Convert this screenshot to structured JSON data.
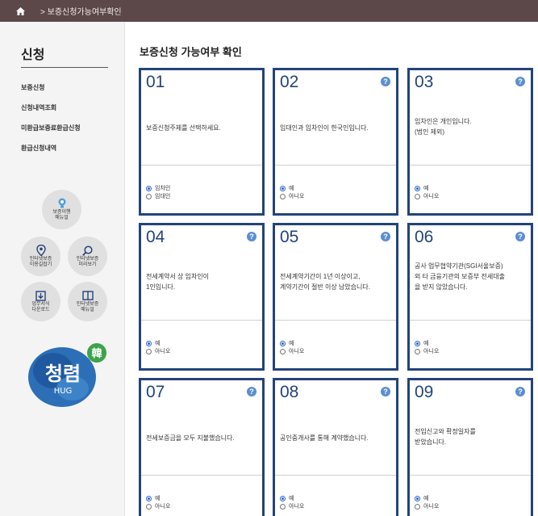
{
  "topbar": {
    "breadcrumb": "> 보증신청가능여부확인"
  },
  "sidebar": {
    "title": "신청",
    "menu": [
      "보증신청",
      "신청내역조회",
      "미환급보증료환급신청",
      "환급신청내역"
    ],
    "shortcuts": [
      {
        "label": "보증이행\n매뉴얼",
        "icon": "bulb-icon"
      },
      {
        "label": "인터넷보증\n이용길잡기",
        "icon": "location-pin-icon"
      },
      {
        "label": "인터넷보증\n미리보기",
        "icon": "magnifier-icon"
      },
      {
        "label": "업무서식\n다운로드",
        "icon": "download-icon"
      },
      {
        "label": "인터넷보증\n매뉴얼",
        "icon": "book-icon"
      }
    ],
    "logo": {
      "text": "청렴",
      "sub": "HUG",
      "badge": "韓"
    }
  },
  "main": {
    "title": "보증신청 가능여부 확인",
    "cards": [
      {
        "num": "01",
        "question": "보증신청주체를 선택하세요.",
        "options": [
          "임차인",
          "임대인"
        ],
        "selected": 0,
        "help": false
      },
      {
        "num": "02",
        "question": "임대인과 임차인이 한국인입니다.",
        "options": [
          "예",
          "아니오"
        ],
        "selected": 0,
        "help": true
      },
      {
        "num": "03",
        "question": "임차인은 개인입니다.\n(법인 제외)",
        "options": [
          "예",
          "아니오"
        ],
        "selected": 0,
        "help": true
      },
      {
        "num": "04",
        "question": "전세계약서 상 임차인이\n1인입니다.",
        "options": [
          "예",
          "아니오"
        ],
        "selected": 0,
        "help": true
      },
      {
        "num": "05",
        "question": "전세계약기간이 1년 이상이고,\n계약기간이 절반 이상 남았습니다.",
        "options": [
          "예",
          "아니오"
        ],
        "selected": 0,
        "help": true
      },
      {
        "num": "06",
        "question": "공사 업무협약기관(SGI서울보증)\n외 타 금융기관의 보증부 전세대출\n을 받지 않았습니다.",
        "options": [
          "예",
          "아니오"
        ],
        "selected": 0,
        "help": true
      },
      {
        "num": "07",
        "question": "전세보증금을 모두 지불했습니다.",
        "options": [
          "예",
          "아니오"
        ],
        "selected": 0,
        "help": true
      },
      {
        "num": "08",
        "question": "공인중개사를 통해 계약했습니다.",
        "options": [
          "예",
          "아니오"
        ],
        "selected": 0,
        "help": true
      },
      {
        "num": "09",
        "question": "전입신고와 확정일자를\n받았습니다.",
        "options": [
          "예",
          "아니오"
        ],
        "selected": 0,
        "help": true
      }
    ],
    "help_glyph": "?"
  },
  "colors": {
    "topbar": "#5c4848",
    "card_border": "#23447a",
    "help_icon": "#5b8fd0",
    "radio_selected": "#2a68c8"
  }
}
